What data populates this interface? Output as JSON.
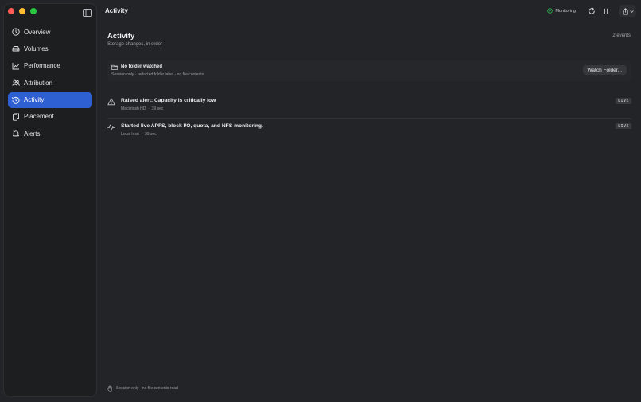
{
  "window": {
    "title": "Activity"
  },
  "sidebar": {
    "items": [
      {
        "label": "Overview",
        "icon": "clock-icon",
        "active": false
      },
      {
        "label": "Volumes",
        "icon": "drive-icon",
        "active": false
      },
      {
        "label": "Performance",
        "icon": "chart-icon",
        "active": false
      },
      {
        "label": "Attribution",
        "icon": "people-icon",
        "active": false
      },
      {
        "label": "Activity",
        "icon": "history-icon",
        "active": true
      },
      {
        "label": "Placement",
        "icon": "documents-icon",
        "active": false
      },
      {
        "label": "Alerts",
        "icon": "bell-icon",
        "active": false
      }
    ]
  },
  "toolbar": {
    "status_label": "Monitoring",
    "status_icon": "check-circle-icon",
    "status_color": "#34c759"
  },
  "main": {
    "title": "Activity",
    "subtitle": "Storage changes, in order",
    "event_count": "2 events",
    "folder_card": {
      "title": "No folder watched",
      "subtitle": "Session only · redacted folder label · no file contents",
      "button_label": "Watch Folder..."
    },
    "events": [
      {
        "icon": "warning-icon",
        "title": "Raised alert: Capacity is critically low",
        "source": "Macintosh HD",
        "separator": "·",
        "time": "39 sec",
        "badge": "LIVE"
      },
      {
        "icon": "waveform-icon",
        "title": "Started live APFS, block I/O, quota, and NFS monitoring.",
        "source": "Local host",
        "separator": "·",
        "time": "39 sec",
        "badge": "LIVE"
      }
    ],
    "footer": "Session only · no file contents read"
  },
  "colors": {
    "accent": "#2f60d3",
    "background": "#232427",
    "sidebar": "#1d1e20"
  }
}
